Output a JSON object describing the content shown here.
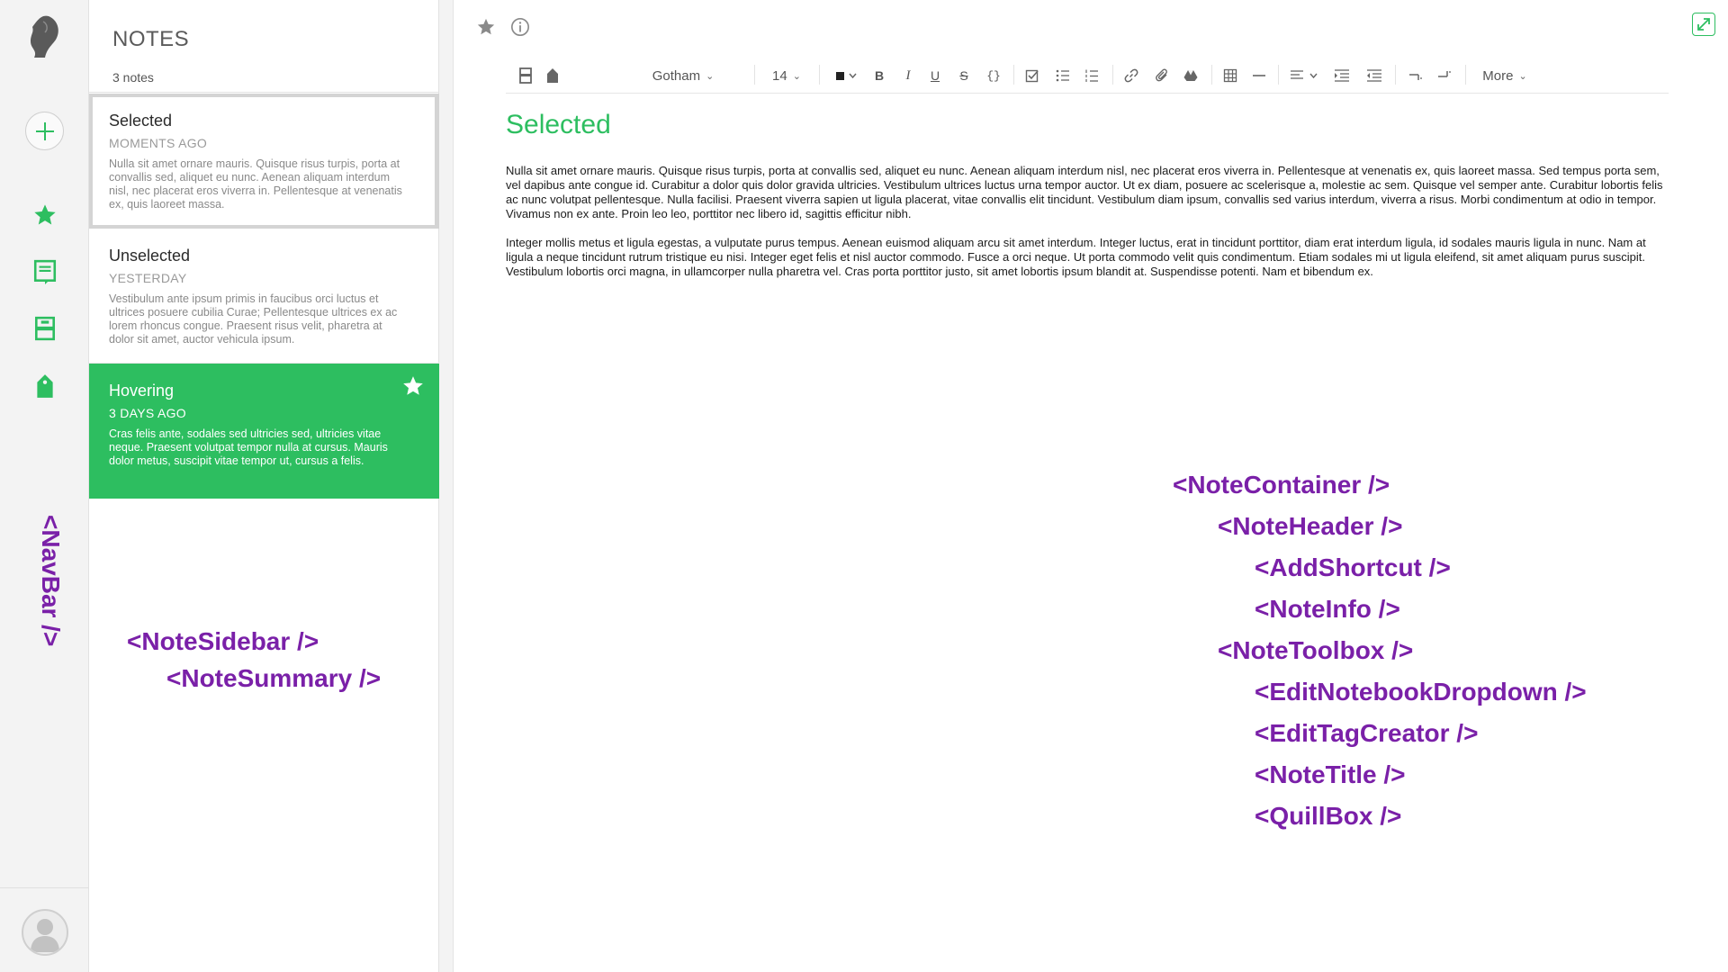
{
  "navbar": {
    "annotation": "<NavBar />",
    "icons": [
      "logo-icon",
      "add-icon",
      "star-icon",
      "notebook-icon",
      "notebooks-icon",
      "tag-icon",
      "avatar-icon"
    ]
  },
  "sidebar": {
    "title": "NOTES",
    "count": "3 notes",
    "notes": [
      {
        "title": "Selected",
        "date": "MOMENTS AGO",
        "body": "Nulla sit amet ornare mauris. Quisque risus turpis, porta at convallis sed, aliquet eu nunc. Aenean aliquam interdum nisl, nec placerat eros viverra in. Pellentesque at venenatis ex, quis laoreet massa."
      },
      {
        "title": "Unselected",
        "date": "YESTERDAY",
        "body": "Vestibulum ante ipsum primis in faucibus orci luctus et ultrices posuere cubilia Curae; Pellentesque ultrices ex ac lorem rhoncus congue. Praesent risus velit, pharetra at dolor sit amet, auctor vehicula ipsum."
      },
      {
        "title": "Hovering",
        "date": "3 DAYS AGO",
        "body": "Cras felis ante, sodales sed ultricies sed, ultricies vitae neque. Praesent volutpat tempor nulla at cursus. Mauris dolor metus, suscipit vitae tempor ut, cursus a felis."
      }
    ],
    "annotations": {
      "sidebar": "<NoteSidebar />",
      "summary": "<NoteSummary />"
    }
  },
  "toolbox": {
    "font": "Gotham",
    "size": "14",
    "more": "More"
  },
  "note": {
    "title": "Selected",
    "paragraphs": [
      "Nulla sit amet ornare mauris. Quisque risus turpis, porta at convallis sed, aliquet eu nunc. Aenean aliquam interdum nisl, nec placerat eros viverra in. Pellentesque at venenatis ex, quis laoreet massa. Sed tempus porta sem, vel dapibus ante congue id. Curabitur a dolor quis dolor gravida ultricies. Vestibulum ultrices luctus urna tempor auctor. Ut ex diam, posuere ac scelerisque a, molestie ac sem. Quisque vel semper ante. Curabitur lobortis felis ac nunc volutpat pellentesque. Nulla facilisi. Praesent viverra sapien ut ligula placerat, vitae convallis elit tincidunt. Vestibulum diam ipsum, convallis sed varius interdum, viverra a risus. Morbi condimentum at odio in tempor. Vivamus non ex ante. Proin leo leo, porttitor nec libero id, sagittis efficitur nibh.",
      "Integer mollis metus et ligula egestas, a vulputate purus tempus. Aenean euismod aliquam arcu sit amet interdum. Integer luctus, erat in tincidunt porttitor, diam erat interdum ligula, id sodales mauris ligula in nunc. Nam at ligula a neque tincidunt rutrum tristique eu nisi. Integer eget felis et nisl auctor commodo. Fusce a orci neque. Ut porta commodo velit quis condimentum. Etiam sodales mi ut ligula eleifend, sit amet aliquam purus suscipit. Vestibulum lobortis orci magna, in ullamcorper nulla pharetra vel. Cras porta porttitor justo, sit amet lobortis ipsum blandit at. Suspendisse potenti. Nam et bibendum ex."
    ]
  },
  "annotations": {
    "container": "<NoteContainer />",
    "header": "<NoteHeader />",
    "add_shortcut": "<AddShortcut />",
    "note_info": "<NoteInfo />",
    "toolbox": "<NoteToolbox />",
    "edit_notebook": "<EditNotebookDropdown />",
    "edit_tag": "<EditTagCreator />",
    "note_title": "<NoteTitle />",
    "quill_box": "<QuillBox />"
  },
  "colors": {
    "brand_green": "#2dbe60",
    "annotation_purple": "#7a20a8"
  }
}
